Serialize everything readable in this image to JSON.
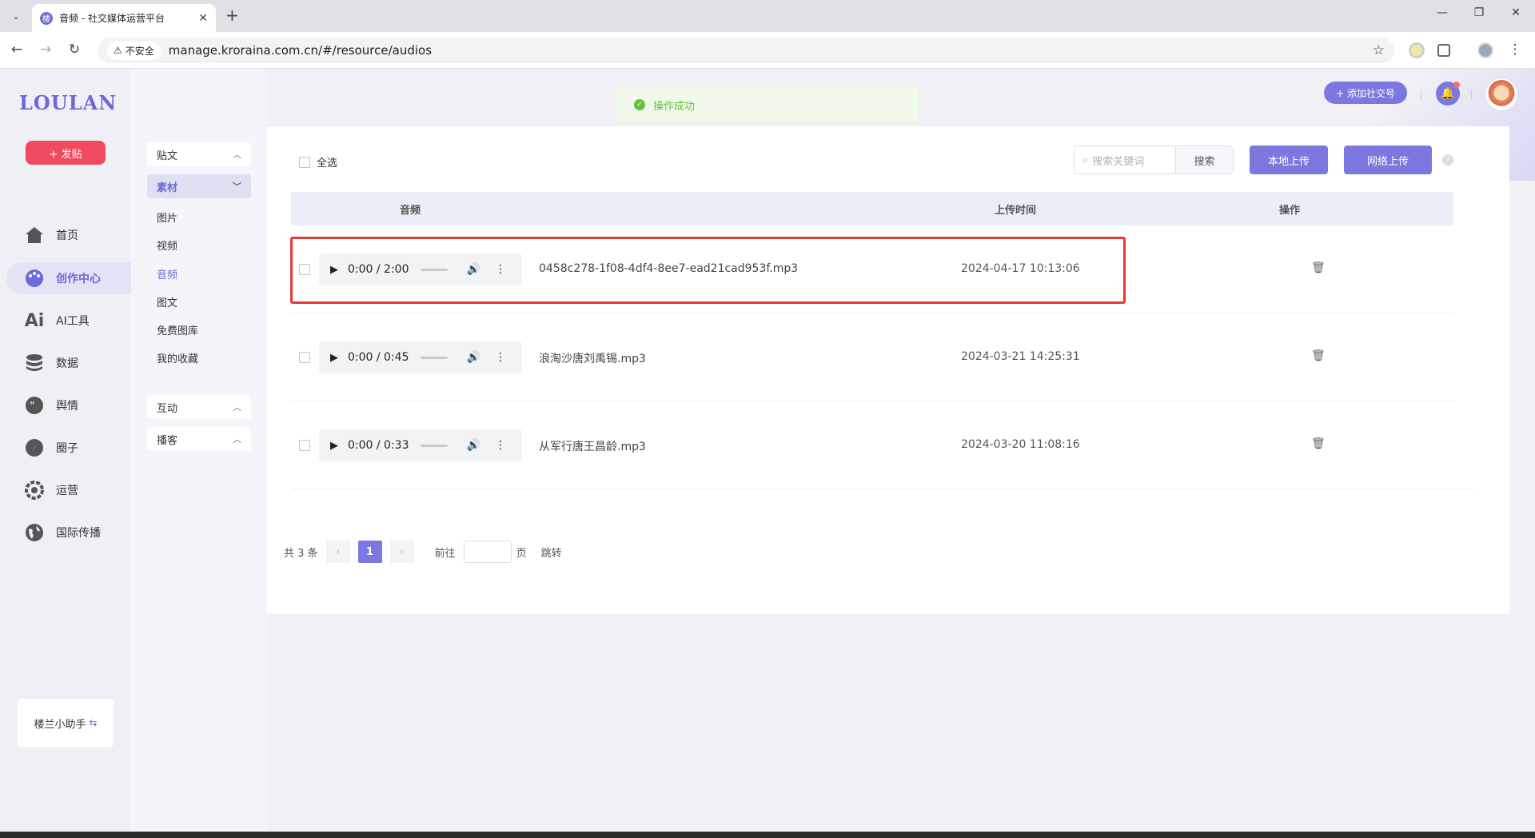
{
  "browser": {
    "tab_title": "音频 - 社交媒体运营平台",
    "security_label": "不安全",
    "url": "manage.kroraina.com.cn/#/resource/audios"
  },
  "sidebar": {
    "logo": "LOULAN",
    "post_button": "+ 发贴",
    "items": [
      {
        "label": "首页",
        "icon": "home-icon"
      },
      {
        "label": "创作中心",
        "icon": "palette-icon",
        "active": true
      },
      {
        "label": "AI工具",
        "icon": "ai-icon"
      },
      {
        "label": "数据",
        "icon": "database-icon"
      },
      {
        "label": "舆情",
        "icon": "quote-icon"
      },
      {
        "label": "圈子",
        "icon": "compass-icon"
      },
      {
        "label": "运营",
        "icon": "gear-icon"
      },
      {
        "label": "国际传播",
        "icon": "globe-icon"
      }
    ],
    "helper": "楼兰小助手"
  },
  "submenu": {
    "groups": [
      {
        "label": "贴文"
      },
      {
        "label": "素材",
        "active": true,
        "children": [
          "图片",
          "视频",
          "音频",
          "图文",
          "免费图库",
          "我的收藏"
        ]
      },
      {
        "label": "互动"
      },
      {
        "label": "播客"
      }
    ]
  },
  "header": {
    "toast": "操作成功",
    "add_social": "+ 添加社交号"
  },
  "toolbar": {
    "select_all": "全选",
    "search_placeholder": "搜索关键词",
    "search_button": "搜索",
    "local_upload": "本地上传",
    "web_upload": "网络上传"
  },
  "table": {
    "columns": [
      "音频",
      "上传时间",
      "操作"
    ],
    "rows": [
      {
        "time": "0:00 / 2:00",
        "name": "0458c278-1f08-4df4-8ee7-ead21cad953f.mp3",
        "uploaded": "2024-04-17 10:13:06"
      },
      {
        "time": "0:00 / 0:45",
        "name": "浪淘沙唐刘禹锡.mp3",
        "uploaded": "2024-03-21 14:25:31"
      },
      {
        "time": "0:00 / 0:33",
        "name": "从军行唐王昌龄.mp3",
        "uploaded": "2024-03-20 11:08:16"
      }
    ]
  },
  "pagination": {
    "total": "共 3 条",
    "current": "1",
    "goto_label": "前往",
    "page_unit": "页",
    "jump": "跳转"
  }
}
